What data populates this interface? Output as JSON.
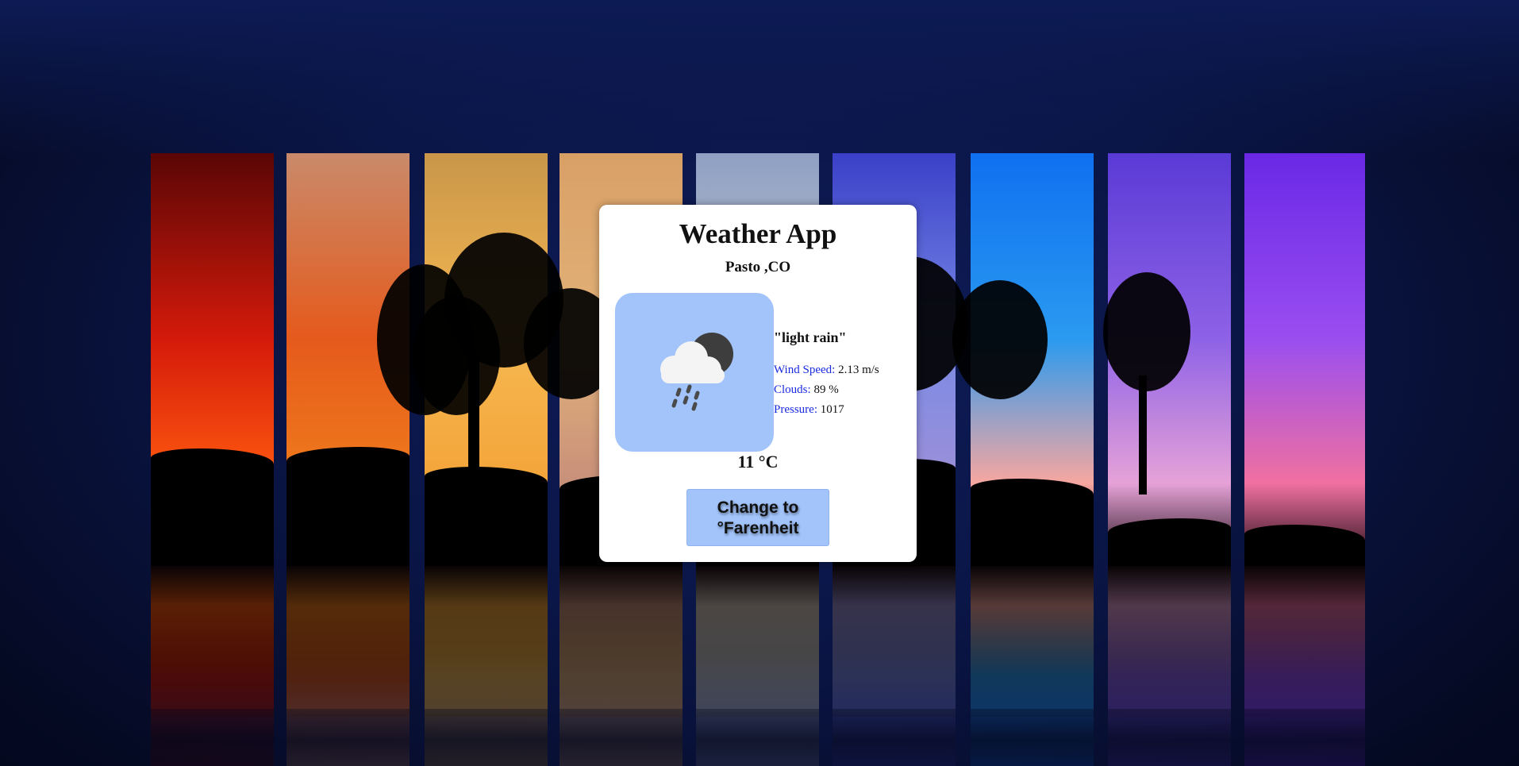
{
  "app": {
    "title": "Weather App",
    "location": "Pasto ,CO"
  },
  "weather": {
    "icon": "cloud-rain-moon-icon",
    "description": "\"light rain\"",
    "stats": [
      {
        "label": "Wind Speed:",
        "value": "2.13 m/s"
      },
      {
        "label": "Clouds:",
        "value": "89 %"
      },
      {
        "label": "Pressure:",
        "value": "1017"
      }
    ],
    "temperature": "11 °C"
  },
  "controls": {
    "unit_toggle_label": "Change to °Farenheit"
  },
  "colors": {
    "accent": "#a2c4fb",
    "stat_label": "#1a2be0",
    "card_bg": "#ffffff",
    "page_bg": "#0a1545"
  },
  "background": {
    "panels": [
      {
        "name": "red-sunset",
        "from": "#5a0606",
        "mid": "#d41a0a",
        "to": "#ff5a10"
      },
      {
        "name": "orange-sunset",
        "from": "#c98a6a",
        "mid": "#e55a1c",
        "to": "#f07b1c"
      },
      {
        "name": "golden-sunset",
        "from": "#c9964a",
        "mid": "#f6b850",
        "to": "#f3a43a"
      },
      {
        "name": "peach-dusk",
        "from": "#d9a066",
        "mid": "#e2b27a",
        "to": "#c8907a"
      },
      {
        "name": "pale-blue",
        "from": "#8fa0c3",
        "mid": "#c2c6d2",
        "to": "#d8c8c0"
      },
      {
        "name": "blue-evening",
        "from": "#3a40c8",
        "mid": "#7a8ae6",
        "to": "#9c90d8"
      },
      {
        "name": "bright-blue",
        "from": "#0f70f0",
        "mid": "#2a9af0",
        "to": "#f7a6a0"
      },
      {
        "name": "violet-dusk",
        "from": "#5a3ad6",
        "mid": "#8e62e6",
        "to": "#e6a2d8"
      },
      {
        "name": "purple-night",
        "from": "#6a28e6",
        "mid": "#9a4ef0",
        "to": "#f070a0"
      }
    ]
  }
}
